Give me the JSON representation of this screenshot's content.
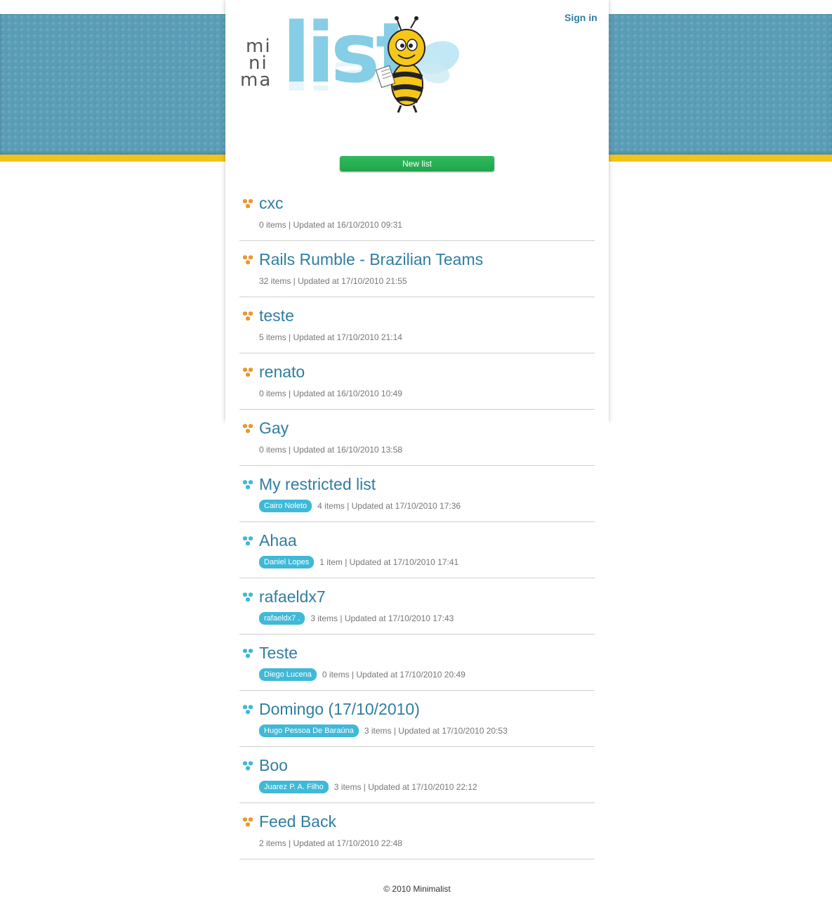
{
  "header": {
    "signin_label": "Sign in",
    "logo": {
      "line1": "mi",
      "line2": "ni",
      "line3": "ma",
      "wordmark": "list"
    },
    "new_list_label": "New list"
  },
  "colors": {
    "link": "#2f7ea0",
    "hive_public": "#e99a2e",
    "hive_restricted": "#3fb9d8",
    "owner_badge": "#3fb9d8",
    "new_list_button": "#2bb557",
    "header_band": "#5a9db6",
    "accent_strip": "#f1c419"
  },
  "lists": [
    {
      "title": "cxc",
      "owner": "",
      "meta": "0 items | Updated at 16/10/2010 09:31",
      "icon": "hive-orange-icon"
    },
    {
      "title": "Rails Rumble - Brazilian Teams",
      "owner": "",
      "meta": "32 items | Updated at 17/10/2010 21:55",
      "icon": "hive-orange-icon"
    },
    {
      "title": "teste",
      "owner": "",
      "meta": "5 items | Updated at 17/10/2010 21:14",
      "icon": "hive-orange-icon"
    },
    {
      "title": "renato",
      "owner": "",
      "meta": "0 items | Updated at 16/10/2010 10:49",
      "icon": "hive-orange-icon"
    },
    {
      "title": "Gay",
      "owner": "",
      "meta": "0 items | Updated at 16/10/2010 13:58",
      "icon": "hive-orange-icon"
    },
    {
      "title": "My restricted list",
      "owner": "Cairo Noleto",
      "meta": "4 items | Updated at 17/10/2010 17:36",
      "icon": "hive-blue-icon"
    },
    {
      "title": "Ahaa",
      "owner": "Daniel Lopes",
      "meta": "1 item | Updated at 17/10/2010 17:41",
      "icon": "hive-blue-icon"
    },
    {
      "title": "rafaeldx7",
      "owner": "rafaeldx7 .",
      "meta": "3 items | Updated at 17/10/2010 17:43",
      "icon": "hive-blue-icon"
    },
    {
      "title": "Teste",
      "owner": "Diego Lucena",
      "meta": "0 items | Updated at 17/10/2010 20:49",
      "icon": "hive-blue-icon"
    },
    {
      "title": "Domingo (17/10/2010)",
      "owner": "Hugo Pessoa De Baraúna",
      "meta": "3 items | Updated at 17/10/2010 20:53",
      "icon": "hive-blue-icon"
    },
    {
      "title": "Boo",
      "owner": "Juarez P. A. Filho",
      "meta": "3 items | Updated at 17/10/2010 22:12",
      "icon": "hive-blue-icon"
    },
    {
      "title": "Feed Back",
      "owner": "",
      "meta": "2 items | Updated at 17/10/2010 22:48",
      "icon": "hive-orange-icon"
    }
  ],
  "footer": {
    "copyright": "© 2010 Minimalist"
  }
}
